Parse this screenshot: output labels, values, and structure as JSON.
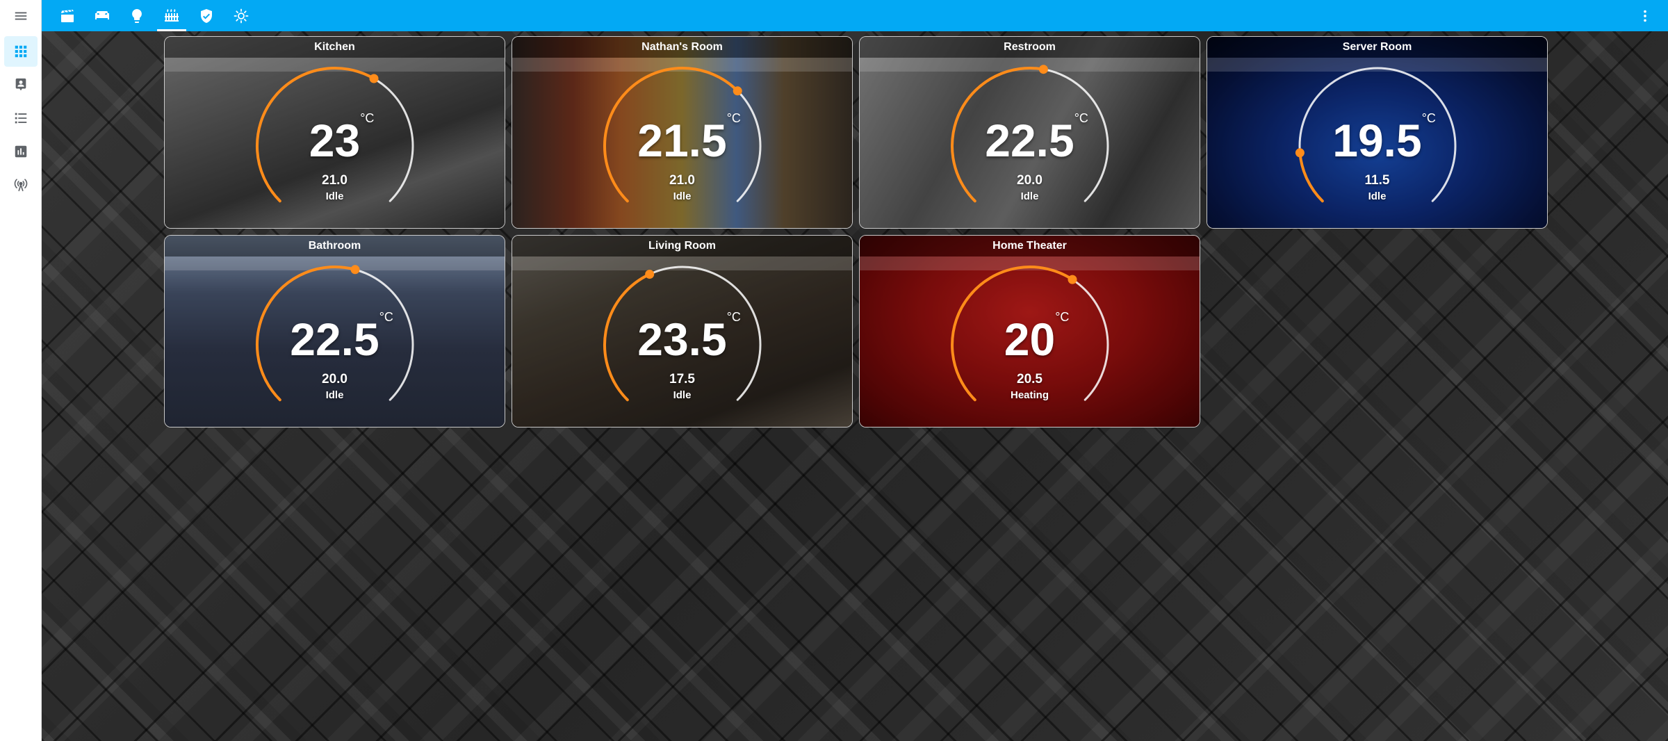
{
  "sidebar": {
    "items": [
      {
        "icon": "dashboard-grid-icon",
        "active": true
      },
      {
        "icon": "map-marker-account-icon",
        "active": false
      },
      {
        "icon": "logbook-list-icon",
        "active": false
      },
      {
        "icon": "history-chart-icon",
        "active": false
      },
      {
        "icon": "broadcast-tower-icon",
        "active": false
      }
    ]
  },
  "topbar": {
    "color": "#03a9f4",
    "tabs": [
      {
        "icon": "theater-clapper-icon"
      },
      {
        "icon": "bed-sofa-icon"
      },
      {
        "icon": "lightbulb-icon"
      },
      {
        "icon": "radiator-icon",
        "active": true
      },
      {
        "icon": "shield-check-icon"
      },
      {
        "icon": "sun-brightness-icon"
      }
    ],
    "overflow_icon": "dots-vertical-icon"
  },
  "accent_color": "#ff8c1a",
  "thermostats": [
    {
      "name": "Kitchen",
      "current": "23",
      "unit": "°C",
      "target": "21.0",
      "action": "Idle"
    },
    {
      "name": "Nathan's Room",
      "current": "21.5",
      "unit": "°C",
      "target": "21.0",
      "action": "Idle"
    },
    {
      "name": "Restroom",
      "current": "22.5",
      "unit": "°C",
      "target": "20.0",
      "action": "Idle"
    },
    {
      "name": "Server Room",
      "current": "19.5",
      "unit": "°C",
      "target": "11.5",
      "action": "Idle"
    },
    {
      "name": "Bathroom",
      "current": "22.5",
      "unit": "°C",
      "target": "20.0",
      "action": "Idle"
    },
    {
      "name": "Living Room",
      "current": "23.5",
      "unit": "°C",
      "target": "17.5",
      "action": "Idle"
    },
    {
      "name": "Home Theater",
      "current": "20",
      "unit": "°C",
      "target": "20.5",
      "action": "Heating"
    }
  ]
}
